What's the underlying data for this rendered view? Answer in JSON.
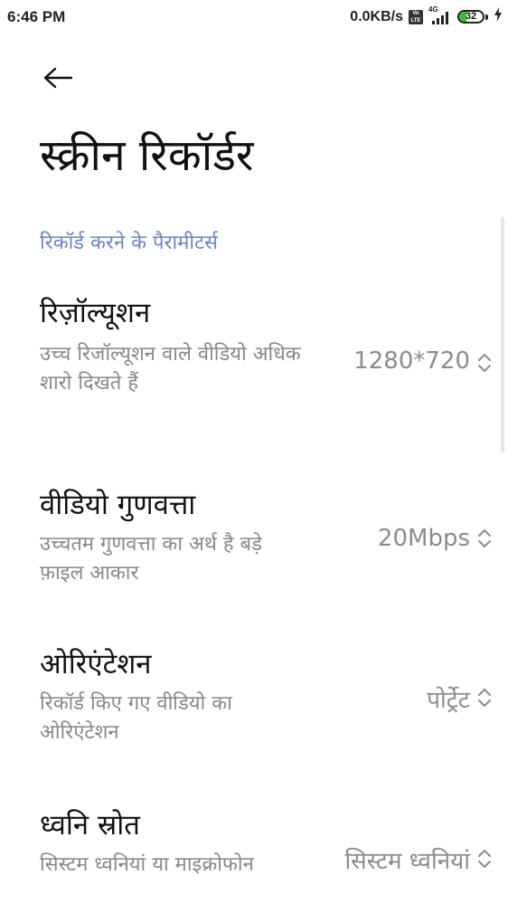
{
  "status_bar": {
    "time": "6:46 PM",
    "net_speed": "0.0KB/s",
    "volte": "Vo LTE",
    "network_type": "4G",
    "battery_level": 32,
    "battery_label": "32",
    "battery_color": "#36c23a",
    "icons": [
      "volte-icon",
      "signal-icon",
      "battery-icon",
      "charging-bolt-icon"
    ]
  },
  "header": {
    "back_icon": "arrow-left-icon",
    "title": "स्क्रीन रिकॉर्डर"
  },
  "section": {
    "label": "रिकॉर्ड करने के पैरामीटर्स",
    "color": "#6a86c7"
  },
  "settings": [
    {
      "title": "रिज़ॉल्यूशन",
      "description": "उच्च रिजॉल्यूशन वाले वीडियो अधिक शारो दिखते हैं",
      "value": "1280*720"
    },
    {
      "title": "वीडियो गुणवत्ता",
      "description": "उच्चतम गुणवत्ता का अर्थ है बड़े फ़ाइल आकार",
      "value": "20Mbps"
    },
    {
      "title": "ओरिएंटेशन",
      "description": "रिकॉर्ड किए गए वीडियो का ओरिएंटेशन",
      "value": "पोर्ट्रेट"
    },
    {
      "title": "ध्वनि स्रोत",
      "description": "सिस्टम ध्वनियां या माइक्रोफोन",
      "value": "सिस्टम ध्वनियां"
    }
  ]
}
